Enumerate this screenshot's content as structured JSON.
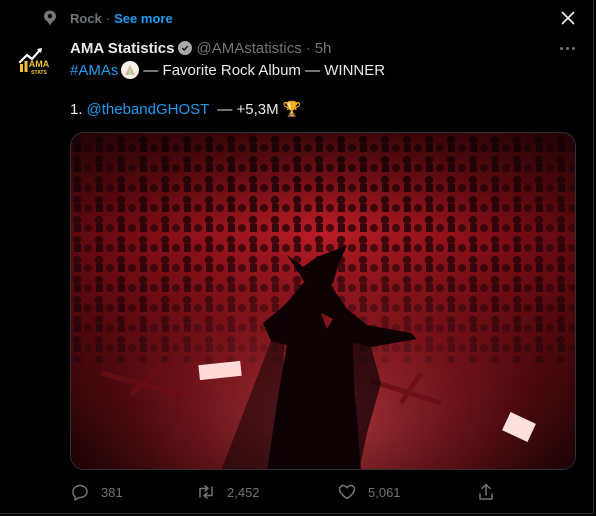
{
  "topic": {
    "name": "Rock",
    "separator": "·",
    "see_more": "See more"
  },
  "tweet": {
    "display_name": "AMA Statistics",
    "handle": "@AMAstatistics",
    "separator": "·",
    "time": "5h",
    "hashtag": "#AMAs",
    "line1_rest": "— Favorite Rock Album — WINNER",
    "rank": "1.",
    "mention": "@thebandGHOST",
    "result": "— +5,3M",
    "trophy": "🏆"
  },
  "avatar": {
    "logo_text": "AMA",
    "logo_sub": "STATS"
  },
  "actions": {
    "replies": "381",
    "retweets": "2,452",
    "likes": "5,061"
  },
  "colors": {
    "accent": "#1d9bf0",
    "muted": "#71767b",
    "text": "#e7e9ea",
    "background": "#000000"
  }
}
